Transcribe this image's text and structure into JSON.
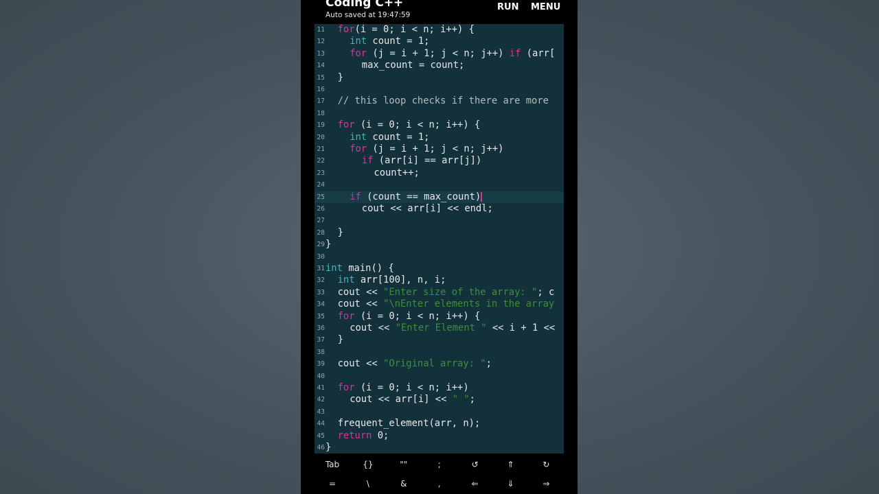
{
  "app": {
    "title": "Coding C++",
    "subtitle": "Auto saved at 19:47:59",
    "run_label": "RUN",
    "menu_label": "MENU"
  },
  "editor": {
    "active_line": 25,
    "lines": [
      {
        "n": "11",
        "indent": 1,
        "tokens": [
          [
            "kw",
            "for"
          ],
          [
            "",
            "(i = 0; i < n; i++) {"
          ]
        ]
      },
      {
        "n": "12",
        "indent": 2,
        "tokens": [
          [
            "type",
            "int"
          ],
          [
            "",
            " count = 1;"
          ]
        ]
      },
      {
        "n": "13",
        "indent": 2,
        "tokens": [
          [
            "kw",
            "for"
          ],
          [
            "",
            " (j = i + 1; j < n; j++) "
          ],
          [
            "kw",
            "if"
          ],
          [
            "",
            " (arr["
          ]
        ]
      },
      {
        "n": "14",
        "indent": 3,
        "tokens": [
          [
            "",
            "max_count = count;"
          ]
        ]
      },
      {
        "n": "15",
        "indent": 1,
        "tokens": [
          [
            "",
            "}"
          ]
        ]
      },
      {
        "n": "16",
        "indent": 0,
        "tokens": []
      },
      {
        "n": "17",
        "indent": 1,
        "tokens": [
          [
            "com",
            "// this loop checks if there are more"
          ]
        ]
      },
      {
        "n": "18",
        "indent": 0,
        "tokens": []
      },
      {
        "n": "19",
        "indent": 1,
        "tokens": [
          [
            "kw",
            "for"
          ],
          [
            "",
            " (i = 0; i < n; i++) {"
          ]
        ]
      },
      {
        "n": "20",
        "indent": 2,
        "tokens": [
          [
            "type",
            "int"
          ],
          [
            "",
            " count = 1;"
          ]
        ]
      },
      {
        "n": "21",
        "indent": 2,
        "tokens": [
          [
            "kw",
            "for"
          ],
          [
            "",
            " (j = i + 1; j < n; j++)"
          ]
        ]
      },
      {
        "n": "22",
        "indent": 3,
        "tokens": [
          [
            "kw",
            "if"
          ],
          [
            "",
            " (arr[i] == arr[j])"
          ]
        ]
      },
      {
        "n": "23",
        "indent": 4,
        "tokens": [
          [
            "",
            "count++;"
          ]
        ]
      },
      {
        "n": "24",
        "indent": 0,
        "tokens": []
      },
      {
        "n": "25",
        "indent": 2,
        "tokens": [
          [
            "kw",
            "if"
          ],
          [
            "",
            " (count == max_count)"
          ],
          [
            "cursor",
            ""
          ]
        ]
      },
      {
        "n": "26",
        "indent": 3,
        "tokens": [
          [
            "",
            "cout << arr[i] << endl;"
          ]
        ]
      },
      {
        "n": "27",
        "indent": 0,
        "tokens": []
      },
      {
        "n": "28",
        "indent": 1,
        "tokens": [
          [
            "",
            "}"
          ]
        ]
      },
      {
        "n": "29",
        "indent": 0,
        "tokens": [
          [
            "",
            "}"
          ]
        ]
      },
      {
        "n": "30",
        "indent": 0,
        "tokens": []
      },
      {
        "n": "31",
        "indent": 0,
        "tokens": [
          [
            "type",
            "int"
          ],
          [
            "",
            " main() {"
          ]
        ]
      },
      {
        "n": "32",
        "indent": 1,
        "tokens": [
          [
            "type",
            "int"
          ],
          [
            "",
            " arr[100], n, i;"
          ]
        ]
      },
      {
        "n": "33",
        "indent": 1,
        "tokens": [
          [
            "",
            "cout << "
          ],
          [
            "str",
            "\"Enter size of the array: \""
          ],
          [
            "",
            "; c"
          ]
        ]
      },
      {
        "n": "34",
        "indent": 1,
        "tokens": [
          [
            "",
            "cout << "
          ],
          [
            "str",
            "\"\\nEnter elements in the array"
          ]
        ]
      },
      {
        "n": "35",
        "indent": 1,
        "tokens": [
          [
            "kw",
            "for"
          ],
          [
            "",
            " (i = 0; i < n; i++) {"
          ]
        ]
      },
      {
        "n": "36",
        "indent": 2,
        "tokens": [
          [
            "",
            "cout << "
          ],
          [
            "str",
            "\"Enter Element \""
          ],
          [
            "",
            " << i + 1 <<"
          ]
        ]
      },
      {
        "n": "37",
        "indent": 1,
        "tokens": [
          [
            "",
            "}"
          ]
        ]
      },
      {
        "n": "38",
        "indent": 0,
        "tokens": []
      },
      {
        "n": "39",
        "indent": 1,
        "tokens": [
          [
            "",
            "cout << "
          ],
          [
            "str",
            "\"Original array: \""
          ],
          [
            "",
            ";"
          ]
        ]
      },
      {
        "n": "40",
        "indent": 0,
        "tokens": []
      },
      {
        "n": "41",
        "indent": 1,
        "tokens": [
          [
            "kw",
            "for"
          ],
          [
            "",
            " (i = 0; i < n; i++)"
          ]
        ]
      },
      {
        "n": "42",
        "indent": 2,
        "tokens": [
          [
            "",
            "cout << arr[i] << "
          ],
          [
            "str",
            "\" \""
          ],
          [
            "",
            ";"
          ]
        ]
      },
      {
        "n": "43",
        "indent": 0,
        "tokens": []
      },
      {
        "n": "44",
        "indent": 1,
        "tokens": [
          [
            "",
            "frequent_element(arr, n);"
          ]
        ]
      },
      {
        "n": "45",
        "indent": 1,
        "tokens": [
          [
            "kw",
            "return"
          ],
          [
            "",
            " 0;"
          ]
        ]
      },
      {
        "n": "46",
        "indent": 0,
        "tokens": [
          [
            "",
            "}"
          ]
        ]
      }
    ]
  },
  "keybar": {
    "row1": [
      {
        "label": "Tab",
        "name": "tab-key"
      },
      {
        "label": "{}",
        "name": "braces-key"
      },
      {
        "label": "\"\"",
        "name": "quotes-key"
      },
      {
        "label": ";",
        "name": "semicolon-key"
      },
      {
        "label": "↺",
        "name": "undo-icon"
      },
      {
        "label": "⇑",
        "name": "arrow-up-icon"
      },
      {
        "label": "↻",
        "name": "redo-icon"
      }
    ],
    "row2": [
      {
        "label": "=",
        "name": "equals-key"
      },
      {
        "label": "\\",
        "name": "backslash-key"
      },
      {
        "label": "&",
        "name": "ampersand-key"
      },
      {
        "label": ",",
        "name": "comma-key"
      },
      {
        "label": "⇐",
        "name": "arrow-left-icon"
      },
      {
        "label": "⇓",
        "name": "arrow-down-icon"
      },
      {
        "label": "⇒",
        "name": "arrow-right-icon"
      }
    ]
  }
}
